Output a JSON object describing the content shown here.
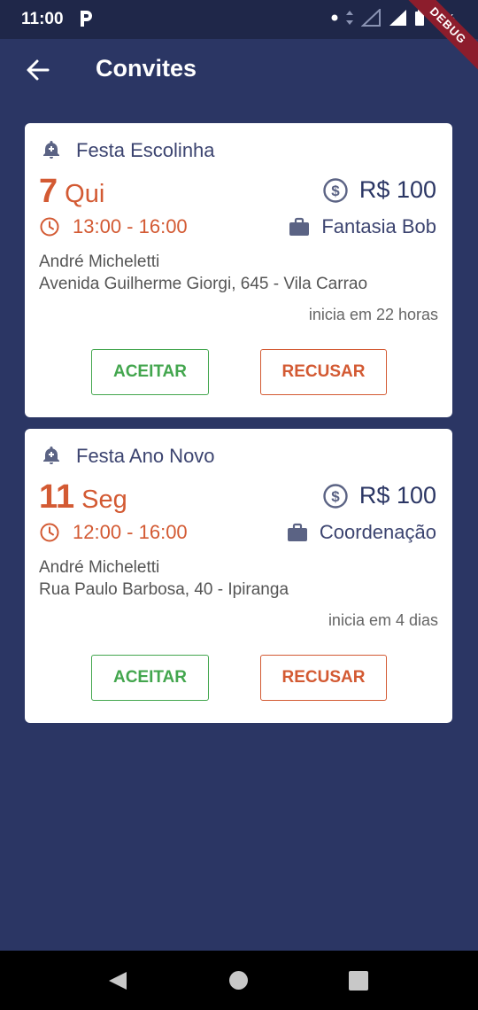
{
  "status_bar": {
    "time": "11:00",
    "battery": "75%",
    "icons": [
      "p-app-icon",
      "dot-icon",
      "data-arrows-icon",
      "signal-icon",
      "signal-x-icon",
      "battery-icon"
    ]
  },
  "debug_banner": "DEBUG",
  "app_bar": {
    "title": "Convites",
    "back_icon": "arrow-back-icon"
  },
  "colors": {
    "primary": "#2b3664",
    "accent_orange": "#d35a33",
    "accept_green": "#43a64e",
    "card_bg": "#ffffff"
  },
  "invites": [
    {
      "title": "Festa Escolinha",
      "day": "7",
      "weekday": "Qui",
      "price": "R$ 100",
      "time": "13:00 - 16:00",
      "role": "Fantasia Bob",
      "host": "André Micheletti",
      "address": "Avenida Guilherme Giorgi, 645 - Vila Carrao",
      "starts_in": "inicia em 22 horas",
      "accept_label": "ACEITAR",
      "refuse_label": "RECUSAR"
    },
    {
      "title": "Festa Ano Novo",
      "day": "11",
      "weekday": "Seg",
      "price": "R$ 100",
      "time": "12:00 - 16:00",
      "role": "Coordenação",
      "host": "André Micheletti",
      "address": "Rua Paulo Barbosa, 40 - Ipiranga",
      "starts_in": "inicia em 4 dias",
      "accept_label": "ACEITAR",
      "refuse_label": "RECUSAR"
    }
  ],
  "nav_bar": {
    "icons": [
      "nav-back-icon",
      "nav-home-icon",
      "nav-recents-icon"
    ]
  }
}
